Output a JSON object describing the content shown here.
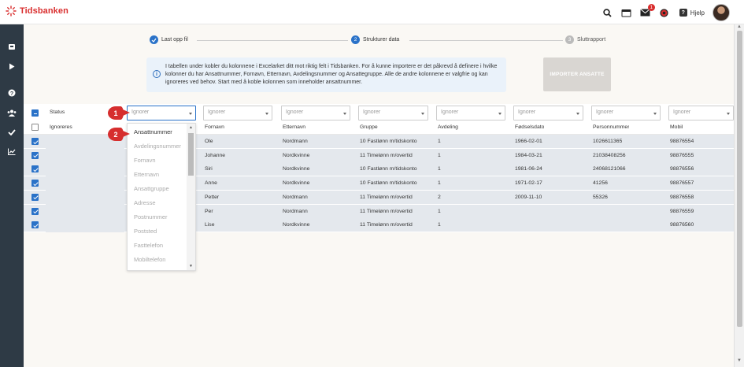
{
  "app": {
    "logo_text": "Tidsbanken"
  },
  "topbar": {
    "help_label": "Hjelp",
    "mail_badge": "1"
  },
  "steps": [
    {
      "label": "Last opp fil",
      "state": "done",
      "number": ""
    },
    {
      "label": "Strukturer data",
      "state": "active",
      "number": "2"
    },
    {
      "label": "Sluttrapport",
      "state": "pending",
      "number": "3"
    }
  ],
  "info": {
    "text": "I tabellen under kobler du kolonnene i Excelarket ditt mot riktig felt i Tidsbanken. For å kunne importere er det påkrevd å definere i hvilke kolonner du har Ansattnummer, Fornavn, Etternavn, Avdelingsnummer og Ansattegruppe. Alle de andre kolonnene er valgfrie og kan ignoreres ved behov. Start med å koble kolonnen som inneholder ansattnummer."
  },
  "import_button": "IMPORTER ANSATTE",
  "table": {
    "status_header": "Status",
    "select_placeholder": "Ignorer",
    "ignore_row_label": "Ignoreres",
    "columns": [
      "Fornavn",
      "Etternavn",
      "Gruppe",
      "Avdeling",
      "Fødselsdato",
      "Personnummer",
      "Mobil"
    ],
    "rows": [
      [
        "Ole",
        "Nordmann",
        "10 Fastlønn m/tidskonto",
        "1",
        "1966-02-01",
        "1026611365",
        "98876554"
      ],
      [
        "Johanne",
        "Nordkvinne",
        "11 Timelønn m/overtid",
        "1",
        "1984-03-21",
        "21038408256",
        "98876555"
      ],
      [
        "Siri",
        "Nordkvinne",
        "10 Fastlønn m/tidskonto",
        "1",
        "1981-06-24",
        "24068121066",
        "98876556"
      ],
      [
        "Anne",
        "Nordkvinne",
        "10 Fastlønn m/tidskonto",
        "1",
        "1971-02-17",
        "41256",
        "98876557"
      ],
      [
        "Petter",
        "Nordmann",
        "11 Timelønn m/overtid",
        "2",
        "2009-11-10",
        "55326",
        "98876558"
      ],
      [
        "Per",
        "Nordmann",
        "11 Timelønn m/overtid",
        "1",
        "",
        "",
        "98876559"
      ],
      [
        "Lise",
        "Nordkvinne",
        "11 Timelønn m/overtid",
        "1",
        "",
        "",
        "98876560"
      ]
    ]
  },
  "dropdown": {
    "options": [
      "Ansattnummer",
      "Avdelingsnummer",
      "Fornavn",
      "Etternavn",
      "Ansattgruppe",
      "Adresse",
      "Postnummer",
      "Poststed",
      "Fasttelefon",
      "Mobiltelefon"
    ]
  },
  "markers": [
    "1",
    "2"
  ],
  "colors": {
    "accent": "#2a72c8",
    "brand_red": "#d92e2e",
    "sidebar": "#2e3a45",
    "marker": "#d62e2e"
  },
  "icons": [
    "search-icon",
    "calendar-icon",
    "mail-icon",
    "settings-icon",
    "help-icon",
    "home-icon",
    "play-icon",
    "info-icon",
    "users-icon",
    "check-icon",
    "chart-icon"
  ]
}
